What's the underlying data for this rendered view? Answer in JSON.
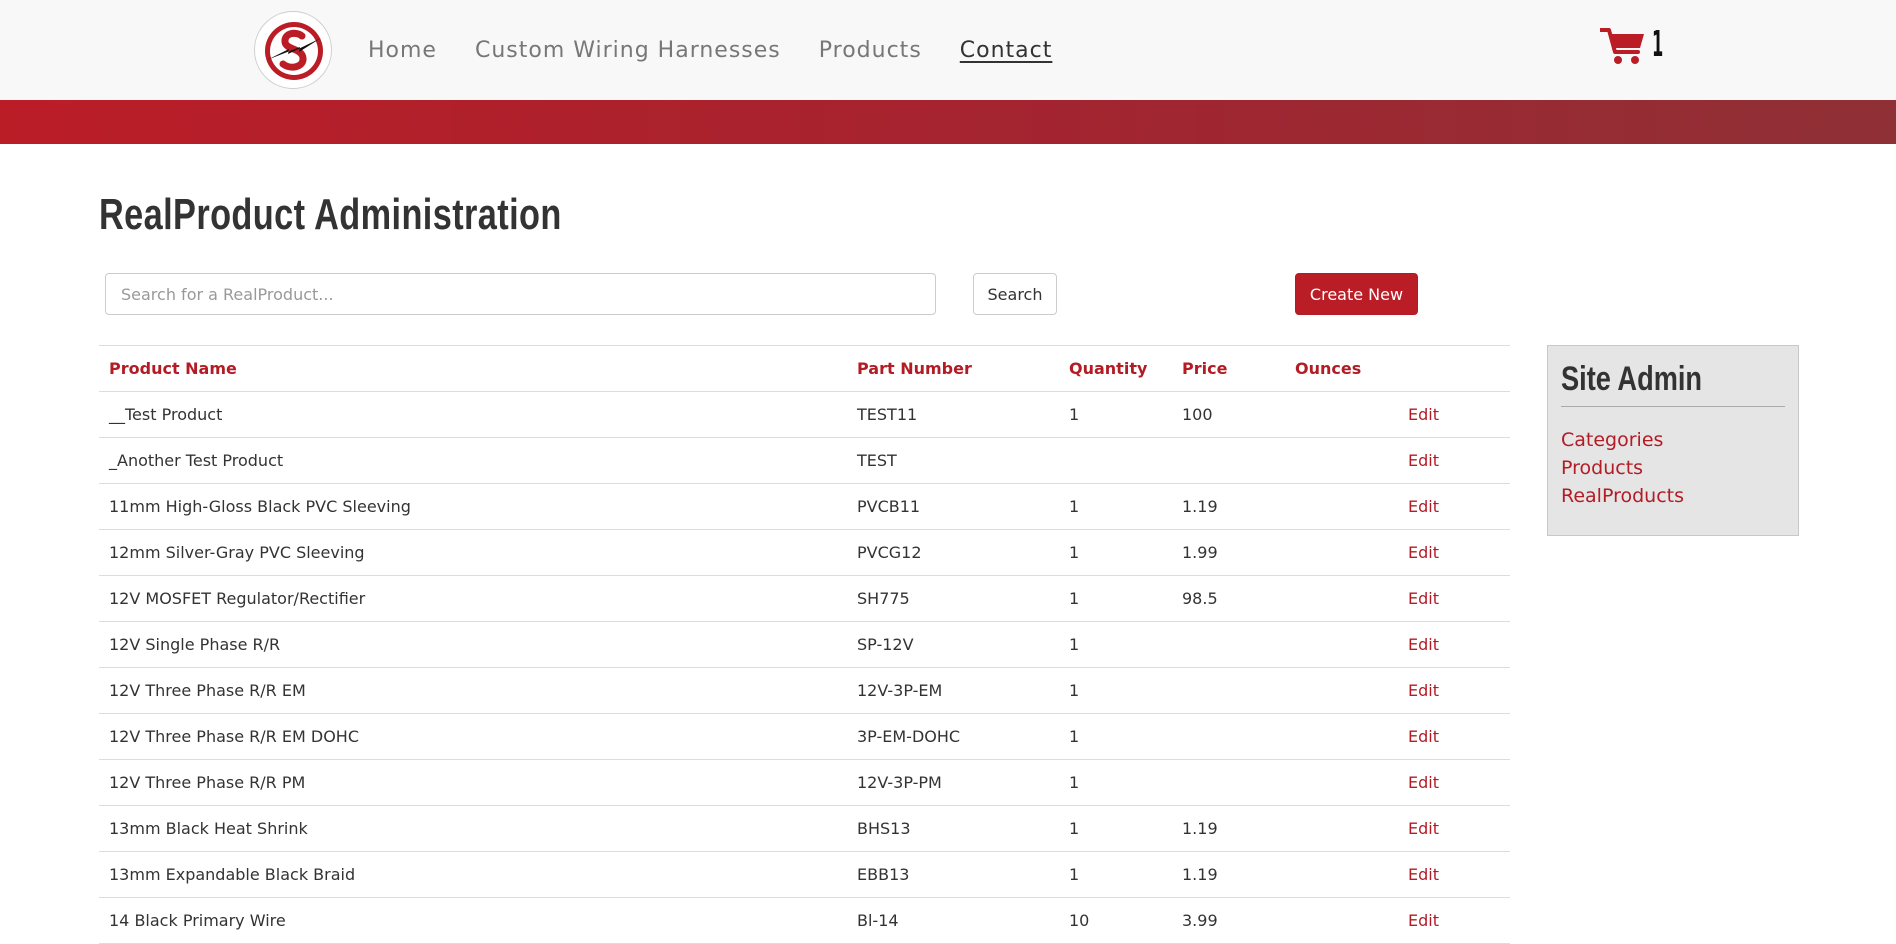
{
  "nav": {
    "items": [
      {
        "label": "Home"
      },
      {
        "label": "Custom Wiring Harnesses"
      },
      {
        "label": "Products"
      },
      {
        "label": "Contact"
      }
    ],
    "cart_count": "1"
  },
  "colors": {
    "brand": "#bb1d27",
    "link": "#b31c25",
    "panel": "#e5e5e5"
  },
  "page": {
    "title": "RealProduct Administration",
    "search_placeholder": "Search for a RealProduct...",
    "search_label": "Search",
    "create_label": "Create New"
  },
  "table": {
    "headers": [
      "Product Name",
      "Part Number",
      "Quantity",
      "Price",
      "Ounces"
    ],
    "edit_label": "Edit",
    "rows": [
      [
        "__Test Product",
        "TEST11",
        "1",
        "100",
        ""
      ],
      [
        "_Another Test Product",
        "TEST",
        "",
        "",
        ""
      ],
      [
        "11mm High-Gloss Black PVC Sleeving",
        "PVCB11",
        "1",
        "1.19",
        ""
      ],
      [
        "12mm Silver-Gray PVC Sleeving",
        "PVCG12",
        "1",
        "1.99",
        ""
      ],
      [
        "12V MOSFET Regulator/Rectifier",
        "SH775",
        "1",
        "98.5",
        ""
      ],
      [
        "12V Single Phase R/R",
        "SP-12V",
        "1",
        "",
        ""
      ],
      [
        "12V Three Phase R/R EM",
        "12V-3P-EM",
        "1",
        "",
        ""
      ],
      [
        "12V Three Phase R/R EM DOHC",
        "3P-EM-DOHC",
        "1",
        "",
        ""
      ],
      [
        "12V Three Phase R/R PM",
        "12V-3P-PM",
        "1",
        "",
        ""
      ],
      [
        "13mm Black Heat Shrink",
        "BHS13",
        "1",
        "1.19",
        ""
      ],
      [
        "13mm Expandable Black Braid",
        "EBB13",
        "1",
        "1.19",
        ""
      ],
      [
        "14 Black Primary Wire",
        "Bl-14",
        "10",
        "3.99",
        ""
      ]
    ]
  },
  "sidebar": {
    "title": "Site Admin",
    "links": [
      {
        "label": "Categories"
      },
      {
        "label": "Products"
      },
      {
        "label": "RealProducts"
      }
    ]
  }
}
